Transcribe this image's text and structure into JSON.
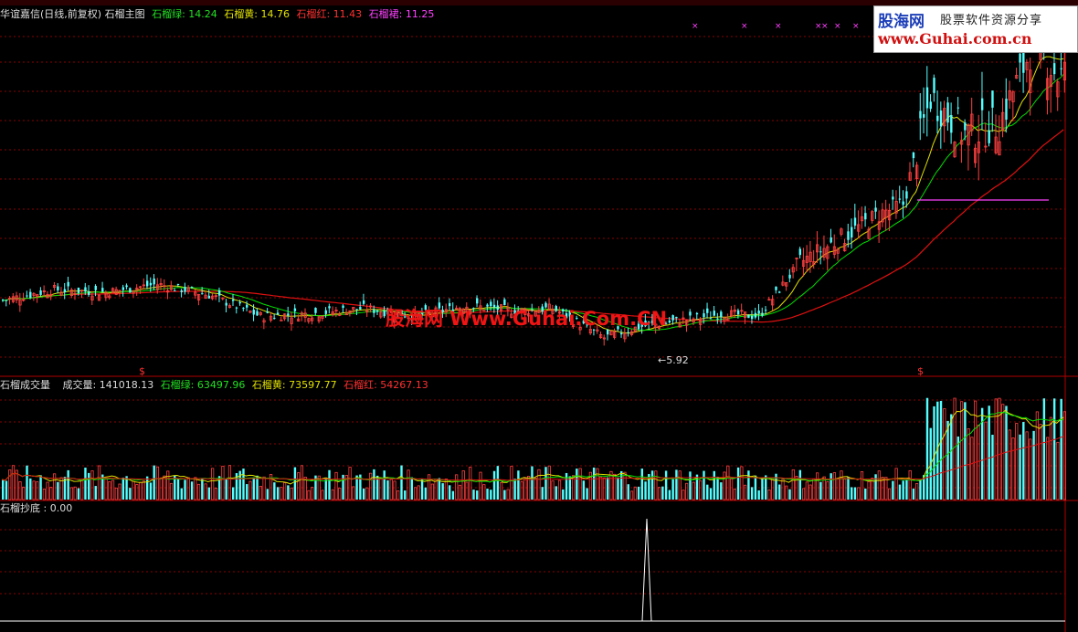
{
  "main_header": {
    "title": "华谊嘉信(日线,前复权) 石榴主图",
    "ma1_label": "石榴绿: 14.24",
    "ma2_label": "石榴黄: 14.76",
    "ma3_label": "石榴红: 11.43",
    "ma4_label": "石榴裙: 11.25"
  },
  "volume_header": {
    "title": "石榴成交量",
    "vol_label": "成交量: 141018.13",
    "ma1_label": "石榴绿: 63497.96",
    "ma2_label": "石榴黄: 73597.77",
    "ma3_label": "石榴红: 54267.13"
  },
  "signal_header": {
    "title": "石榴抄底 : 0.00"
  },
  "watermark": {
    "site_cn": "股海网",
    "tagline": "股票软件资源分享",
    "url": "www.Guhai.com.cn",
    "center_text": "股海网 Www.Guhai.Com.CN"
  },
  "low_marker": "←5.92",
  "colors": {
    "up": "#ff4040",
    "down": "#54ffff",
    "ma_green": "#00e000",
    "ma_yellow": "#e0e000",
    "ma_red": "#e01010",
    "ma_magenta": "#ff40ff",
    "grid": "#8b0000"
  },
  "chart_data": [
    {
      "type": "candlestick",
      "title": "华谊嘉信(日线,前复权) 石榴主图",
      "series": [
        {
          "name": "石榴绿",
          "last": 14.24
        },
        {
          "name": "石榴黄",
          "last": 14.76
        },
        {
          "name": "石榴红",
          "last": 11.43
        },
        {
          "name": "石榴裙",
          "last": 11.25
        }
      ],
      "price_points": [
        {
          "i": 0,
          "p": 7.6
        },
        {
          "i": 15,
          "p": 8.0
        },
        {
          "i": 30,
          "p": 7.9
        },
        {
          "i": 45,
          "p": 8.2
        },
        {
          "i": 60,
          "p": 7.8
        },
        {
          "i": 75,
          "p": 7.0
        },
        {
          "i": 90,
          "p": 7.1
        },
        {
          "i": 105,
          "p": 7.3
        },
        {
          "i": 120,
          "p": 7.0
        },
        {
          "i": 135,
          "p": 7.4
        },
        {
          "i": 150,
          "p": 7.2
        },
        {
          "i": 160,
          "p": 7.3
        },
        {
          "i": 175,
          "p": 6.2
        },
        {
          "i": 185,
          "p": 6.6
        },
        {
          "i": 195,
          "p": 6.8
        },
        {
          "i": 210,
          "p": 7.1
        },
        {
          "i": 220,
          "p": 7.0
        },
        {
          "i": 232,
          "p": 9.0
        },
        {
          "i": 245,
          "p": 10.0
        },
        {
          "i": 255,
          "p": 10.8
        },
        {
          "i": 262,
          "p": 11.2
        },
        {
          "i": 270,
          "p": 15.2
        },
        {
          "i": 280,
          "p": 13.8
        },
        {
          "i": 290,
          "p": 14.2
        },
        {
          "i": 300,
          "p": 17.2
        },
        {
          "i": 307,
          "p": 16.0
        }
      ],
      "low_mark": 5.92
    },
    {
      "type": "bar",
      "title": "石榴成交量",
      "series": [
        {
          "name": "成交量",
          "last": 141018.13
        },
        {
          "name": "石榴绿",
          "last": 63497.96
        },
        {
          "name": "石榴黄",
          "last": 73597.77
        },
        {
          "name": "石榴红",
          "last": 54267.13
        }
      ]
    },
    {
      "type": "line",
      "title": "石榴抄底",
      "series": [
        {
          "name": "石榴抄底",
          "last": 0.0
        }
      ],
      "spikes": [
        {
          "i": 184,
          "value": 1
        }
      ]
    }
  ]
}
